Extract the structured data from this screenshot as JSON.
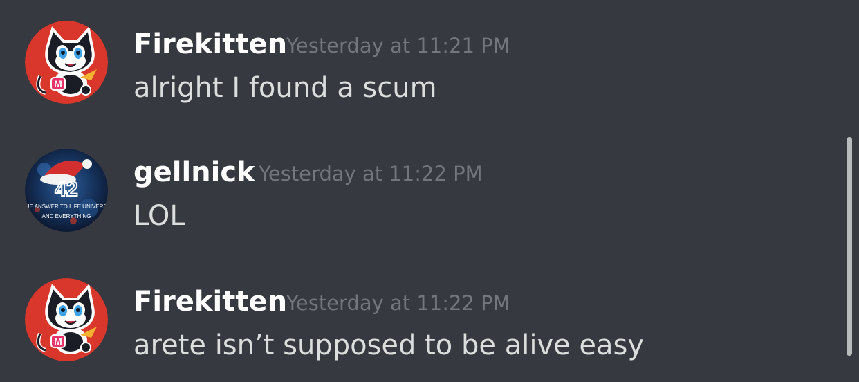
{
  "messages": [
    {
      "username": "Firekitten",
      "timestamp": "Yesterday at 11:21 PM",
      "text": "alright I found a scum",
      "avatar": "cat-mascot-avatar"
    },
    {
      "username": "gellnick",
      "timestamp": "Yesterday at 11:22 PM",
      "text": "LOL",
      "avatar": "santa-hat-42-avatar",
      "avatar_caption": "THE ANSWER TO LIFE UNIVERSE AND EVERYTHING"
    },
    {
      "username": "Firekitten",
      "timestamp": "Yesterday at 11:22 PM",
      "text": "arete isn’t supposed to be alive easy",
      "avatar": "cat-mascot-avatar"
    }
  ],
  "colors": {
    "background": "#36393f",
    "username": "#ffffff",
    "message_text": "#dcddde",
    "timestamp": "#72767d",
    "avatar_red": "#d9372c",
    "scrollbar": "#b9bbbe"
  }
}
